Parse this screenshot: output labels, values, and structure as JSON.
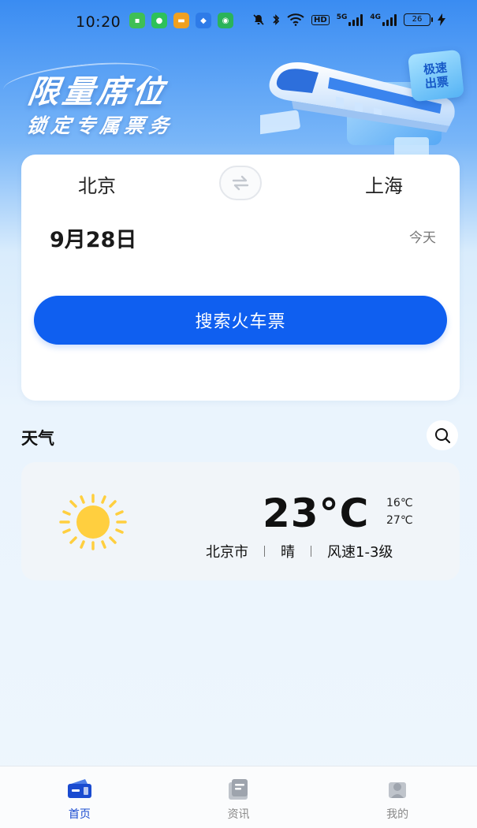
{
  "status_bar": {
    "time": "10:20",
    "network_hd": "HD",
    "signal_1": "5G",
    "signal_2": "4G",
    "battery": "26"
  },
  "banner": {
    "title": "限量席位",
    "subtitle": "锁定专属票务",
    "badge_line1": "极速",
    "badge_line2": "出票"
  },
  "booking": {
    "from_city": "北京",
    "to_city": "上海",
    "date": "9月28日",
    "day_label": "今天",
    "search_label": "搜索火车票"
  },
  "weather": {
    "section_title": "天气",
    "temperature": "23°C",
    "temp_high": "16℃",
    "temp_low": "27℃",
    "city": "北京市",
    "condition": "晴",
    "wind": "风速1-3级"
  },
  "tabbar": {
    "tabs": [
      {
        "label": "首页",
        "active": true
      },
      {
        "label": "资讯",
        "active": false
      },
      {
        "label": "我的",
        "active": false
      }
    ]
  },
  "colors": {
    "primary": "#0f5ff0",
    "tab_active": "#1a4bd0",
    "sun": "#ffcf3f"
  }
}
